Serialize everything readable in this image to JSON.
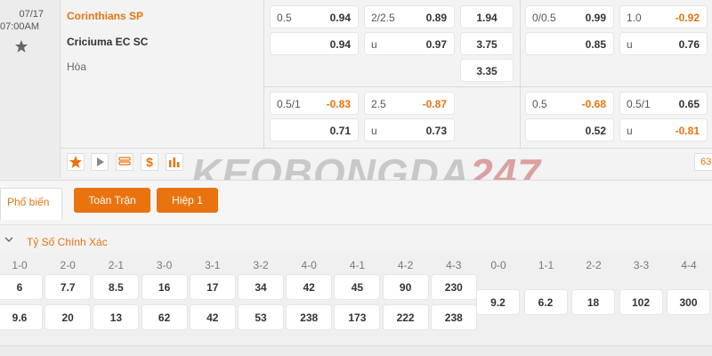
{
  "match": {
    "date": "07/17",
    "time": "07:00AM",
    "team1": "Corinthians SP",
    "team2": "Criciuma EC SC",
    "draw": "Hòa"
  },
  "odds": {
    "r1": {
      "hcap": "0.5",
      "hcap_v": "0.94",
      "ou": "2/2.5",
      "ou_v": "0.89",
      "x1": "1.94",
      "h1_hcap": "0/0.5",
      "h1_hcap_v": "0.99",
      "h1_ou": "1.0",
      "h1_ou_v": "-0.92"
    },
    "r2": {
      "hcap_v": "0.94",
      "ou": "u",
      "ou_v": "0.97",
      "x1": "3.75",
      "h1_hcap_v": "0.85",
      "h1_ou": "u",
      "h1_ou_v": "0.76"
    },
    "r3": {
      "x1": "3.35"
    },
    "r4": {
      "hcap": "0.5/1",
      "hcap_v": "-0.83",
      "ou": "2.5",
      "ou_v": "-0.87",
      "h1_hcap": "0.5",
      "h1_hcap_v": "-0.68",
      "h1_ou": "0.5/1",
      "h1_ou_v": "0.65"
    },
    "r5": {
      "hcap_v": "0.71",
      "ou": "u",
      "ou_v": "0.73",
      "h1_hcap_v": "0.52",
      "h1_ou": "u",
      "h1_ou_v": "-0.81"
    }
  },
  "toolbar": {
    "icons": [
      "star-icon",
      "play-icon",
      "list-icon",
      "dollar-icon",
      "stats-icon"
    ],
    "page_num": "63"
  },
  "watermark": {
    "text": "KEOBONGDA",
    "num": "247"
  },
  "tabs": {
    "popular": "Phổ biến",
    "full": "Toàn Trận",
    "half": "Hiệp 1"
  },
  "section": {
    "title": "Tỷ Số Chính Xác"
  },
  "scores": {
    "home_labels": [
      "1-0",
      "2-0",
      "2-1",
      "3-0",
      "3-1",
      "3-2",
      "4-0",
      "4-1",
      "4-2",
      "4-3"
    ],
    "home_row": [
      "6",
      "7.7",
      "8.5",
      "16",
      "17",
      "34",
      "42",
      "45",
      "90",
      "230"
    ],
    "away_row": [
      "9.6",
      "20",
      "13",
      "62",
      "42",
      "53",
      "238",
      "173",
      "222",
      "238"
    ],
    "draw_labels": [
      "0-0",
      "1-1",
      "2-2",
      "3-3",
      "4-4"
    ],
    "draw_row": [
      "9.2",
      "6.2",
      "18",
      "102",
      "300"
    ]
  },
  "colors": {
    "accent": "#e8730f",
    "negative": "#e8730f"
  }
}
